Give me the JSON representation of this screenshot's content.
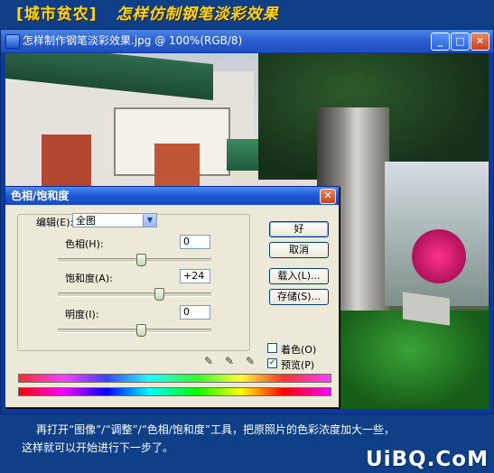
{
  "header": {
    "tag": "[城市贫农]",
    "title": "怎样仿制钢笔淡彩效果"
  },
  "document_window": {
    "title": "怎样制作钢笔淡彩效果.jpg @ 100%(RGB/8)",
    "minimize_glyph": "_",
    "maximize_glyph": "□",
    "close_glyph": "✕"
  },
  "dialog": {
    "title": "色相/饱和度",
    "edit_label": "编辑(E):",
    "edit_value": "全图",
    "sliders": [
      {
        "label": "色相(H):",
        "value": "0",
        "level": 0.54
      },
      {
        "label": "饱和度(A):",
        "value": "+24",
        "level": 0.66
      },
      {
        "label": "明度(I):",
        "value": "0",
        "level": 0.54
      }
    ],
    "buttons": {
      "ok": "好",
      "cancel": "取消",
      "load": "载入(L)...",
      "save": "存储(S)..."
    },
    "checkboxes": {
      "colorize": {
        "label": "着色(O)",
        "checked": false
      },
      "preview": {
        "label": "预览(P)",
        "checked": true
      }
    }
  },
  "caption": {
    "line1": "再打开“图像”/“调整”/“色相/饱和度”工具，把原照片的色彩浓度加大一些，",
    "line2": "这样就可以开始进行下一步了。"
  },
  "watermark": "UiBQ.CoM",
  "colors": {
    "page_bg": "#0f3f86",
    "header_text": "#ffd51a",
    "titlebar_blue": "#2c5fd2",
    "dialog_bg": "#ece9d8"
  },
  "icons": [
    "document-icon",
    "minimize-icon",
    "maximize-icon",
    "close-icon",
    "dropdown-arrow-icon",
    "eyedropper-icon",
    "eyedropper-plus-icon",
    "eyedropper-minus-icon"
  ]
}
